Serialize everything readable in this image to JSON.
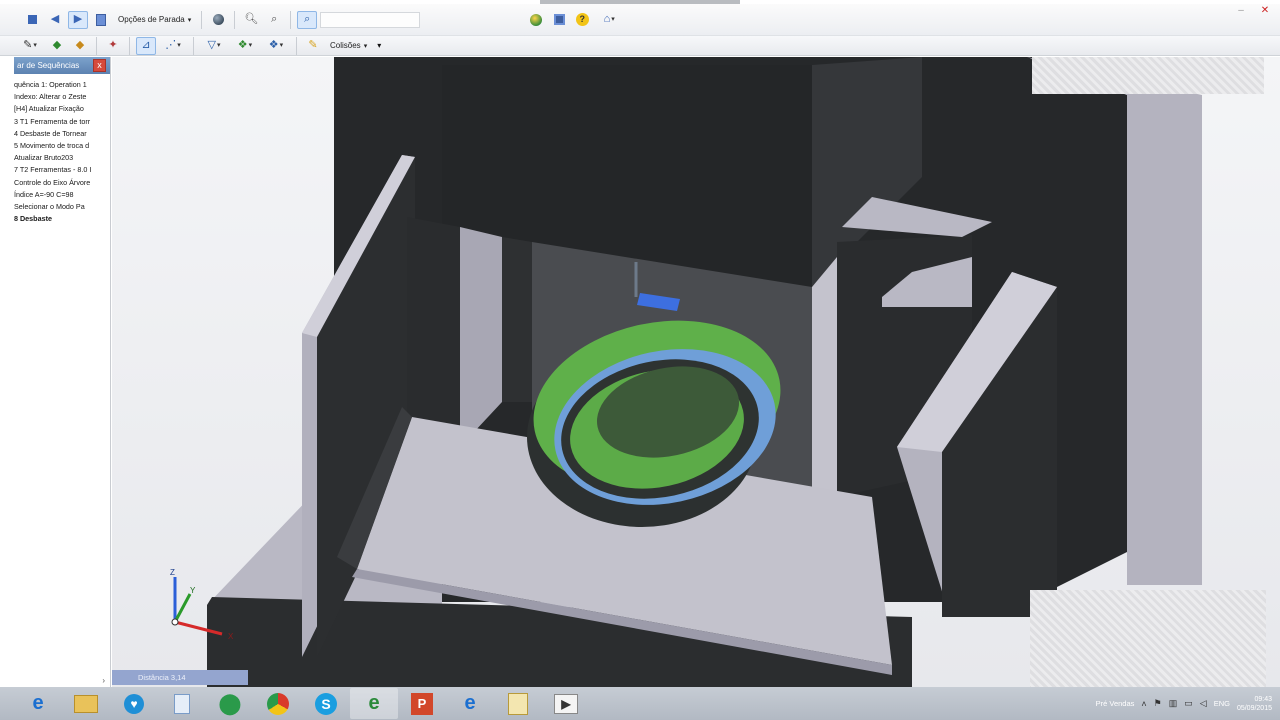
{
  "toolbar1": {
    "stop_options_label": "Opções de Parada"
  },
  "toolbar2": {
    "collisions_label": "Colisões"
  },
  "sequence_panel": {
    "title": "ar de Sequências",
    "close_label": "x",
    "items": [
      {
        "label": "quência 1: Operation 1",
        "bold": false
      },
      {
        "label": "Indexo: Alterar o Zeste",
        "bold": false
      },
      {
        "label": "[H4] Atualizar Fixação",
        "bold": false
      },
      {
        "label": "3 T1 Ferramenta de torr",
        "bold": false
      },
      {
        "label": "4 Desbaste de Tornear",
        "bold": false
      },
      {
        "label": "5 Movimento de troca d",
        "bold": false
      },
      {
        "label": "Atualizar Bruto203",
        "bold": false
      },
      {
        "label": "7 T2 Ferramentas - 8.0 I",
        "bold": false
      },
      {
        "label": "Controle do Eixo Árvore",
        "bold": false
      },
      {
        "label": "Índice A=-90 C=98",
        "bold": false
      },
      {
        "label": "Selecionar o Modo Pa",
        "bold": false
      },
      {
        "label": "8 Desbaste",
        "bold": true
      }
    ],
    "scroll_arrow": "›"
  },
  "axes": {
    "z": "Z",
    "y": "Y",
    "x": "X"
  },
  "status": {
    "left": "Distância 3,14"
  },
  "tray": {
    "lang": "Pré Vendas",
    "ptb": "ENG",
    "time": "09:43",
    "date": "05/09/2015"
  },
  "colors": {
    "accent": "#5c82b1",
    "part_green": "#5fb04a",
    "part_blue": "#6f9fd8",
    "fixture_gray": "#b9b8c4",
    "fixture_dark": "#2a2c2e"
  }
}
